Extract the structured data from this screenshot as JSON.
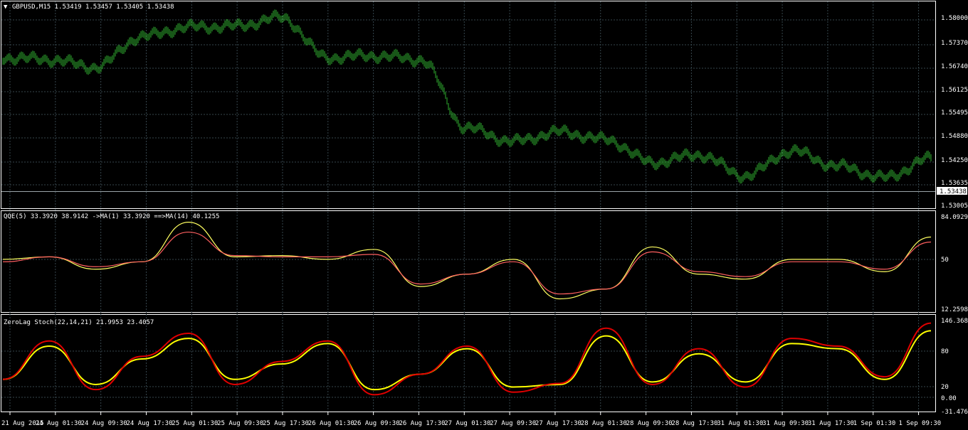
{
  "main": {
    "header": "GBPUSD,M15  1.53419 1.53457 1.53405 1.53438",
    "bid_label": "1.53438",
    "price_ticks": [
      "1.58000",
      "1.57370",
      "1.56740",
      "1.56125",
      "1.55495",
      "1.54880",
      "1.54250",
      "1.53635",
      "1.53005"
    ]
  },
  "qqe": {
    "header": "QQE(5) 33.3920 38.9142  ->MA(1) 33.3920  ==>MA(14) 40.1255",
    "ticks": [
      "84.0929",
      "50",
      "12.2598"
    ]
  },
  "stoch": {
    "header": "ZeroLag Stoch(22,14,21) 21.9953 23.4057",
    "ticks": [
      "146.3682",
      "80",
      "20",
      "0.00",
      "-31.4766"
    ]
  },
  "time_labels": [
    "21 Aug 2015",
    "24 Aug 01:30",
    "24 Aug 09:30",
    "24 Aug 17:30",
    "25 Aug 01:30",
    "25 Aug 09:30",
    "25 Aug 17:30",
    "26 Aug 01:30",
    "26 Aug 09:30",
    "26 Aug 17:30",
    "27 Aug 01:30",
    "27 Aug 09:30",
    "27 Aug 17:30",
    "28 Aug 01:30",
    "28 Aug 09:30",
    "28 Aug 17:30",
    "31 Aug 01:30",
    "31 Aug 09:30",
    "31 Aug 17:30",
    "1 Sep 01:30",
    "1 Sep 09:30"
  ],
  "colors": {
    "price": "#2fae2f",
    "qqe_fast": "#ffff60",
    "qqe_slow": "#ff5f5f",
    "stoch_fast": "#ffff00",
    "stoch_slow": "#e00000",
    "grid": "#36464d"
  },
  "chart_data": [
    {
      "type": "line",
      "title": "GBPUSD,M15",
      "ylim": [
        1.53005,
        1.58
      ],
      "x": [
        0,
        5,
        10,
        15,
        20,
        25,
        30,
        35,
        40,
        45,
        50,
        55,
        60,
        65,
        70,
        75,
        80,
        85,
        90,
        95,
        100
      ],
      "series": [
        {
          "values": [
            1.569,
            1.5685,
            1.5665,
            1.5745,
            1.577,
            1.5772,
            1.5795,
            1.569,
            1.5695,
            1.5685,
            1.5505,
            1.547,
            1.5495,
            1.5475,
            1.5415,
            1.5435,
            1.538,
            1.5445,
            1.5405,
            1.5375,
            1.5425
          ]
        }
      ]
    },
    {
      "type": "line",
      "title": "QQE(5)",
      "ylim": [
        12.2598,
        84.0929
      ],
      "x": [
        0,
        5,
        10,
        15,
        20,
        25,
        30,
        35,
        40,
        45,
        50,
        55,
        60,
        65,
        70,
        75,
        80,
        85,
        90,
        95,
        100
      ],
      "series": [
        {
          "values": [
            52,
            54,
            44,
            50,
            82,
            54,
            55,
            52,
            60,
            30,
            40,
            52,
            20,
            28,
            62,
            40,
            36,
            52,
            52,
            42,
            70
          ]
        },
        {
          "values": [
            50,
            54,
            46,
            50,
            74,
            55,
            54,
            54,
            56,
            32,
            40,
            50,
            24,
            28,
            58,
            42,
            38,
            50,
            50,
            44,
            66
          ]
        }
      ]
    },
    {
      "type": "line",
      "title": "ZeroLag Stoch(22,14,21)",
      "ylim": [
        -31.4766,
        146.3682
      ],
      "x": [
        0,
        5,
        10,
        15,
        20,
        25,
        30,
        35,
        40,
        45,
        50,
        55,
        60,
        65,
        70,
        75,
        80,
        85,
        90,
        95,
        100
      ],
      "series": [
        {
          "values": [
            30,
            95,
            20,
            70,
            110,
            30,
            60,
            100,
            10,
            40,
            90,
            15,
            20,
            115,
            25,
            80,
            25,
            100,
            90,
            30,
            125
          ]
        },
        {
          "values": [
            30,
            105,
            10,
            75,
            120,
            20,
            65,
            105,
            0,
            40,
            95,
            5,
            22,
            130,
            20,
            90,
            15,
            110,
            95,
            35,
            140
          ]
        }
      ]
    }
  ]
}
